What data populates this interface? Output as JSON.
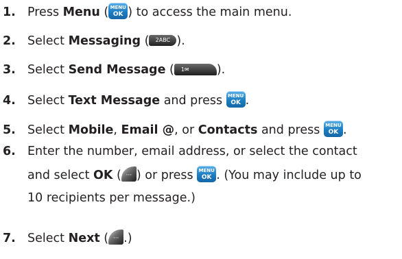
{
  "steps": [
    {
      "num": "1.",
      "a": "Press ",
      "b1": "Menu",
      "c": " (",
      "d": ") to access the main menu."
    },
    {
      "num": "2.",
      "a": "Select ",
      "b1": "Messaging",
      "c": " (",
      "d": ")."
    },
    {
      "num": "3.",
      "a": "Select ",
      "b1": "Send Message",
      "c": " (",
      "d": ")."
    },
    {
      "num": "4.",
      "a": "Select ",
      "b1": "Text Message",
      "c": " and press ",
      "d": "."
    },
    {
      "num": "5.",
      "a": "Select ",
      "b1": "Mobile",
      "c": ", ",
      "b2": "Email @",
      "e": ", or ",
      "b3": "Contacts",
      "f": " and press ",
      "g": "."
    },
    {
      "num": "6.",
      "line1": "Enter the number, email address, or select the contact",
      "a": "and select ",
      "b1": "OK",
      "c": " (",
      "d": ") or press ",
      "e": ". (You may include up to",
      "line3": "10 recipients per message.)"
    },
    {
      "num": "7.",
      "a": "Select ",
      "b1": "Next",
      "c": " (",
      "d": ".)"
    }
  ],
  "icons": {
    "menu_ok": {
      "line1": "MENU",
      "line2": "OK"
    },
    "key_2": "2ABC",
    "key_1": "1✉",
    "softkey": "···"
  }
}
